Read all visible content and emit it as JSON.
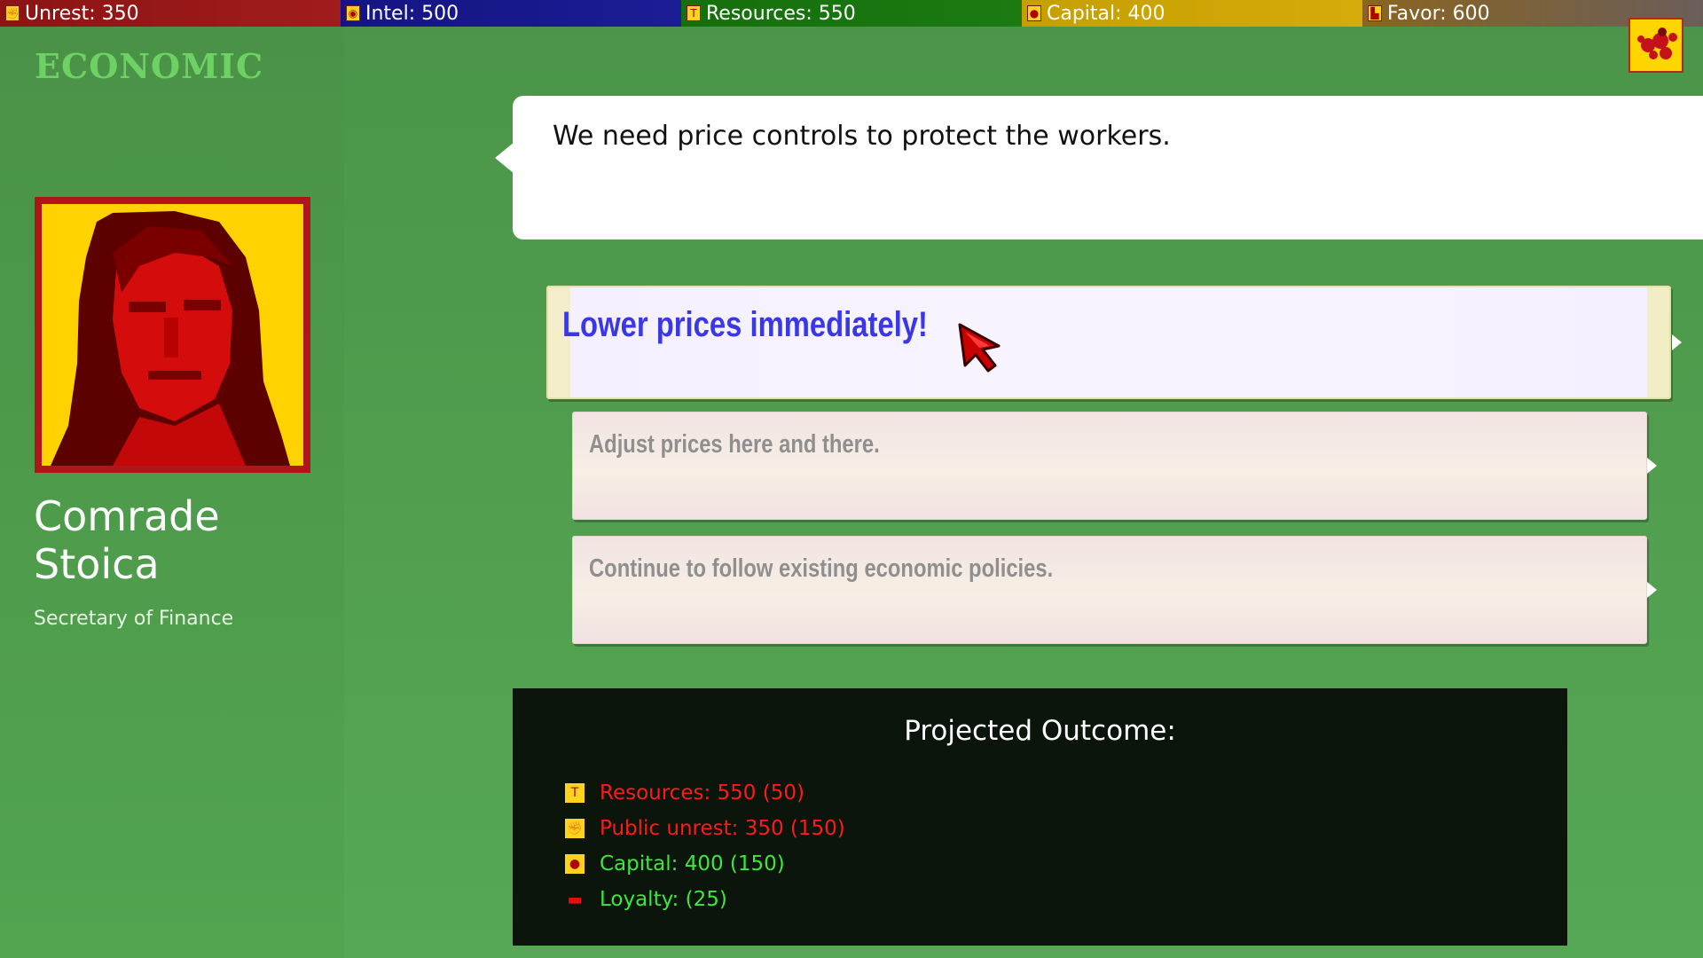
{
  "topbar": {
    "unrest": "Unrest: 350",
    "intel": "Intel: 500",
    "resources": "Resources: 550",
    "capital": "Capital: 400",
    "favor": "Favor: 600"
  },
  "advisor": {
    "category": "ECONOMIC",
    "name": "Comrade Stoica",
    "role": "Secretary of Finance"
  },
  "speech": "We need price controls to protect the workers.",
  "choices": [
    {
      "label": "Lower prices immediately!",
      "state": "hovered"
    },
    {
      "label": "Adjust prices here and there."
    },
    {
      "label": "Continue to follow existing economic policies."
    }
  ],
  "outcome": {
    "title": "Projected Outcome:",
    "items": [
      {
        "icon": "hammer-icon",
        "label": "Resources: 550 (50)",
        "tone": "negative"
      },
      {
        "icon": "fist-icon",
        "label": "Public unrest: 350 (150)",
        "tone": "negative"
      },
      {
        "icon": "money-bag-icon",
        "label": "Capital: 400 (150)",
        "tone": "positive"
      },
      {
        "icon": "handshake-icon",
        "label": "Loyalty: (25)",
        "tone": "positive"
      }
    ]
  },
  "colors": {
    "background": "#4e9c4b",
    "hover_text": "#3a37e6",
    "negative": "#ff1a1a",
    "positive": "#3ce83c",
    "portrait_bg": "#ffd200"
  }
}
